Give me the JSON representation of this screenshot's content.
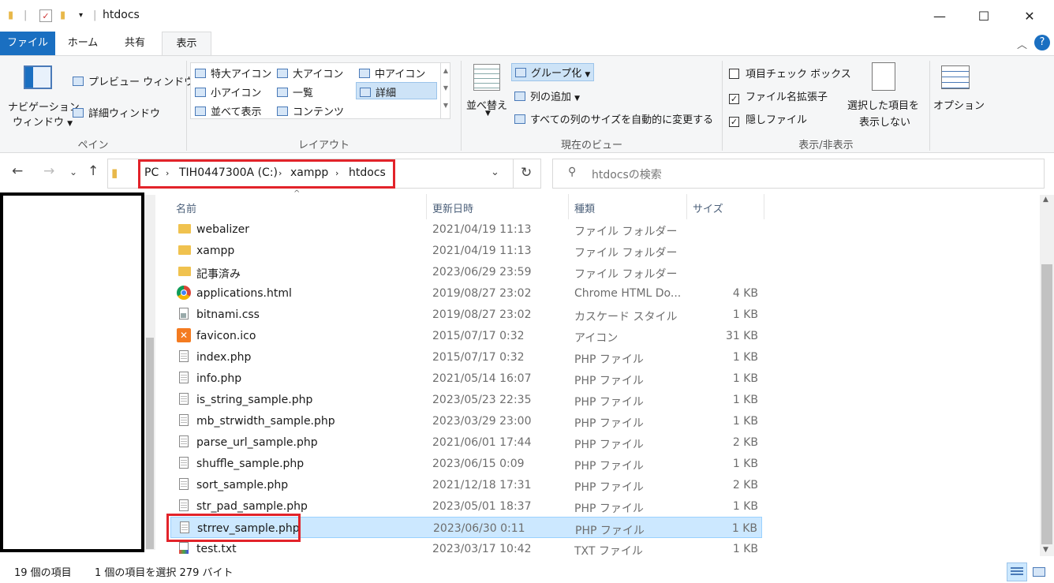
{
  "window": {
    "title": "htdocs",
    "minimize": "—",
    "maximize": "☐",
    "close": "✕"
  },
  "ribbon_tabs": [
    "ファイル",
    "ホーム",
    "共有",
    "表示"
  ],
  "ribbon": {
    "pane": {
      "nav_pane": "ナビゲーション",
      "nav_pane_2": "ウィンドウ",
      "preview": "プレビュー ウィンドウ",
      "details": "詳細ウィンドウ",
      "group": "ペイン"
    },
    "layout": {
      "items": [
        "特大アイコン",
        "大アイコン",
        "中アイコン",
        "小アイコン",
        "一覧",
        "詳細",
        "並べて表示",
        "コンテンツ"
      ],
      "group": "レイアウト"
    },
    "current_view": {
      "sort": "並べ替え",
      "group_by": "グループ化",
      "add_column": "列の追加",
      "autosize": "すべての列のサイズを自動的に変更する",
      "group": "現在のビュー"
    },
    "show_hide": {
      "item_checkbox": "項目チェック ボックス",
      "extensions": "ファイル名拡張子",
      "hidden": "隠しファイル",
      "hide_selected_1": "選択した項目を",
      "hide_selected_2": "表示しない",
      "group": "表示/非表示"
    },
    "options": "オプション"
  },
  "address": {
    "crumbs": [
      "PC",
      "TIH0447300A (C:)",
      "xampp",
      "htdocs"
    ],
    "search_placeholder": "htdocsの検索"
  },
  "columns": [
    "名前",
    "更新日時",
    "種類",
    "サイズ"
  ],
  "files": [
    {
      "name": "webalizer",
      "date": "2021/04/19 11:13",
      "type": "ファイル フォルダー",
      "size": "",
      "icon": "folder-icon"
    },
    {
      "name": "xampp",
      "date": "2021/04/19 11:13",
      "type": "ファイル フォルダー",
      "size": "",
      "icon": "folder-icon"
    },
    {
      "name": "記事済み",
      "date": "2023/06/29 23:59",
      "type": "ファイル フォルダー",
      "size": "",
      "icon": "folder-icon"
    },
    {
      "name": "applications.html",
      "date": "2019/08/27 23:02",
      "type": "Chrome HTML Do...",
      "size": "4 KB",
      "icon": "chrome-icon"
    },
    {
      "name": "bitnami.css",
      "date": "2019/08/27 23:02",
      "type": "カスケード スタイル シ...",
      "size": "1 KB",
      "icon": "css-file-icon"
    },
    {
      "name": "favicon.ico",
      "date": "2015/07/17 0:32",
      "type": "アイコン",
      "size": "31 KB",
      "icon": "xampp-icon"
    },
    {
      "name": "index.php",
      "date": "2015/07/17 0:32",
      "type": "PHP ファイル",
      "size": "1 KB",
      "icon": "file-icon"
    },
    {
      "name": "info.php",
      "date": "2021/05/14 16:07",
      "type": "PHP ファイル",
      "size": "1 KB",
      "icon": "file-icon"
    },
    {
      "name": "is_string_sample.php",
      "date": "2023/05/23 22:35",
      "type": "PHP ファイル",
      "size": "1 KB",
      "icon": "file-icon"
    },
    {
      "name": "mb_strwidth_sample.php",
      "date": "2023/03/29 23:00",
      "type": "PHP ファイル",
      "size": "1 KB",
      "icon": "file-icon"
    },
    {
      "name": "parse_url_sample.php",
      "date": "2021/06/01 17:44",
      "type": "PHP ファイル",
      "size": "2 KB",
      "icon": "file-icon"
    },
    {
      "name": "shuffle_sample.php",
      "date": "2023/06/15 0:09",
      "type": "PHP ファイル",
      "size": "1 KB",
      "icon": "file-icon"
    },
    {
      "name": "sort_sample.php",
      "date": "2021/12/18 17:31",
      "type": "PHP ファイル",
      "size": "2 KB",
      "icon": "file-icon"
    },
    {
      "name": "str_pad_sample.php",
      "date": "2023/05/01 18:37",
      "type": "PHP ファイル",
      "size": "1 KB",
      "icon": "file-icon"
    },
    {
      "name": "strrev_sample.php",
      "date": "2023/06/30 0:11",
      "type": "PHP ファイル",
      "size": "1 KB",
      "icon": "file-icon",
      "selected": true
    },
    {
      "name": "test.txt",
      "date": "2023/03/17 10:42",
      "type": "TXT ファイル",
      "size": "1 KB",
      "icon": "text-file-icon"
    }
  ],
  "status": {
    "count": "19 個の項目",
    "selection": "1 個の項目を選択 279 バイト"
  },
  "colors": {
    "accent": "#1a6fc1",
    "highlight": "#e2232a",
    "selection": "#cce8ff"
  }
}
